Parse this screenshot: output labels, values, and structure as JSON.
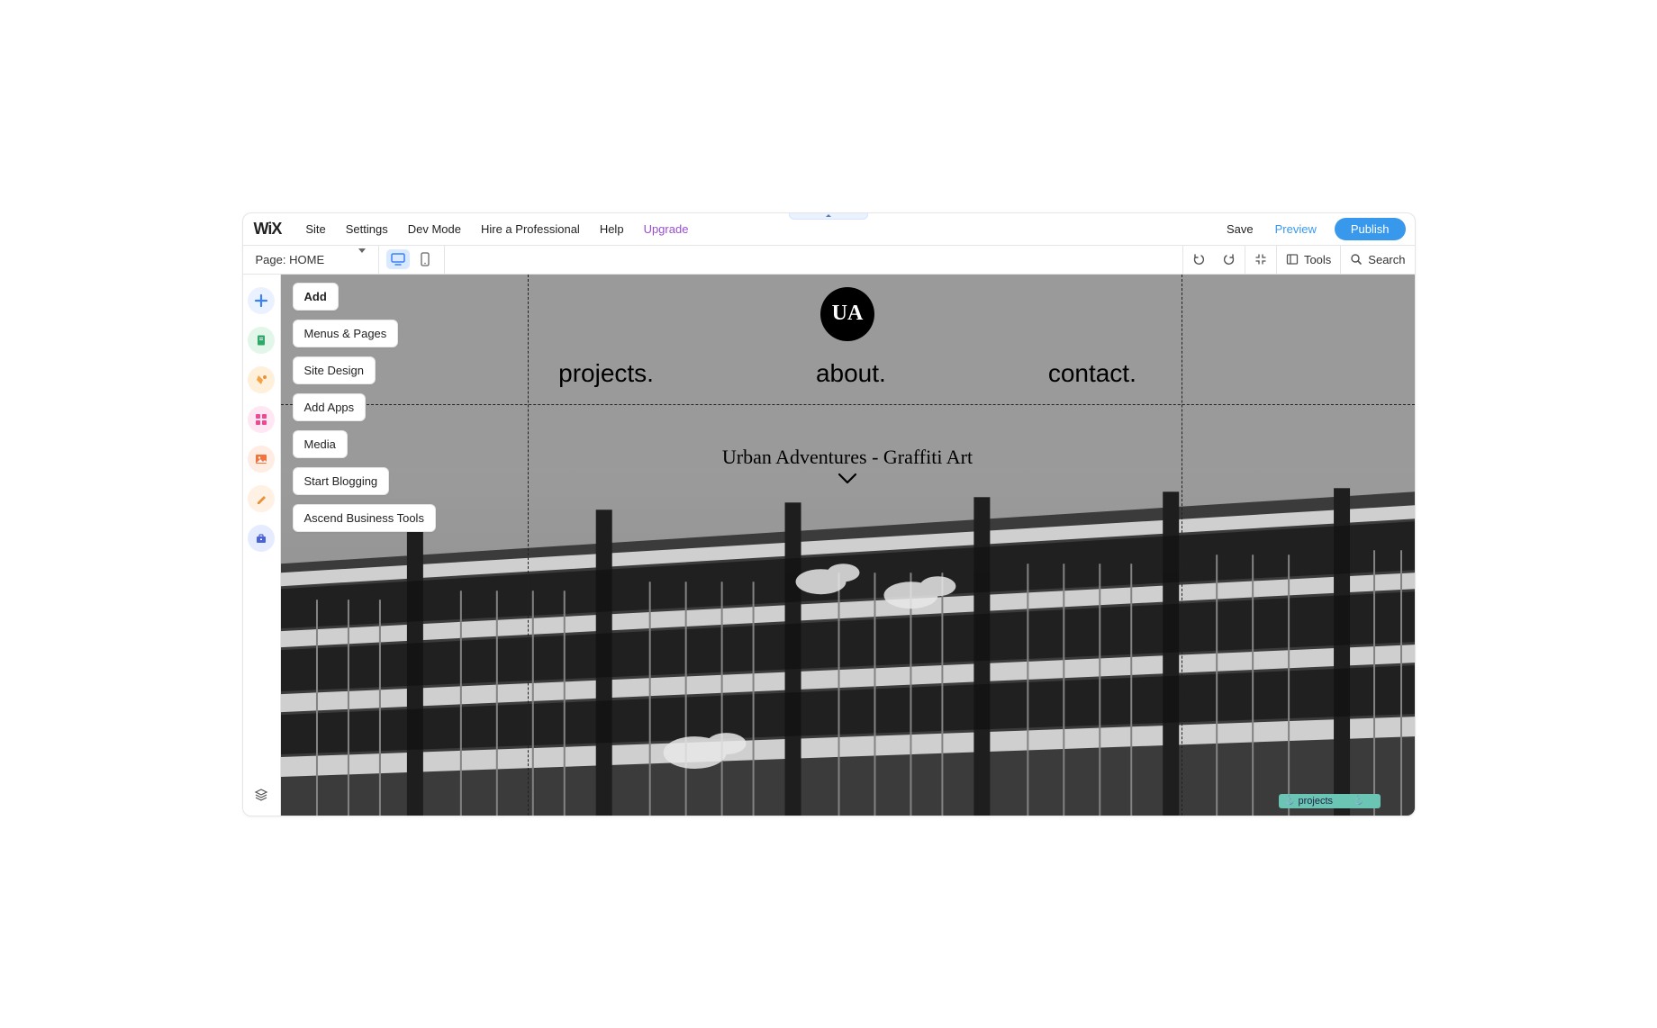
{
  "menubar": {
    "logo": "WiX",
    "items": [
      "Site",
      "Settings",
      "Dev Mode",
      "Hire a Professional",
      "Help"
    ],
    "upgrade": "Upgrade",
    "save": "Save",
    "preview": "Preview",
    "publish": "Publish"
  },
  "toolbar": {
    "page_prefix": "Page:",
    "page_name": "HOME",
    "tools": "Tools",
    "search": "Search"
  },
  "left_tooltips": {
    "items": [
      {
        "label": "Add",
        "bold": true
      },
      {
        "label": "Menus & Pages",
        "bold": false
      },
      {
        "label": "Site Design",
        "bold": false
      },
      {
        "label": "Add Apps",
        "bold": false
      },
      {
        "label": "Media",
        "bold": false
      },
      {
        "label": "Start Blogging",
        "bold": false
      },
      {
        "label": "Ascend Business Tools",
        "bold": false
      }
    ]
  },
  "leftbar_icons": [
    {
      "name": "add",
      "bg": "#eaf2ff",
      "fg": "#3b82f6"
    },
    {
      "name": "pages",
      "bg": "#e3f6ea",
      "fg": "#2fa968"
    },
    {
      "name": "design",
      "bg": "#fff0db",
      "fg": "#f6a144"
    },
    {
      "name": "apps",
      "bg": "#ffe7f3",
      "fg": "#ec4a92"
    },
    {
      "name": "media",
      "bg": "#ffece3",
      "fg": "#f1743e"
    },
    {
      "name": "blog",
      "bg": "#fff1e3",
      "fg": "#e8913a"
    },
    {
      "name": "ascend",
      "bg": "#e6ecff",
      "fg": "#4a63d8"
    }
  ],
  "site": {
    "logo_initials": "UA",
    "nav": [
      "projects.",
      "about.",
      "contact."
    ],
    "title": "Urban Adventures - Graffiti Art",
    "anchor": "projects"
  }
}
